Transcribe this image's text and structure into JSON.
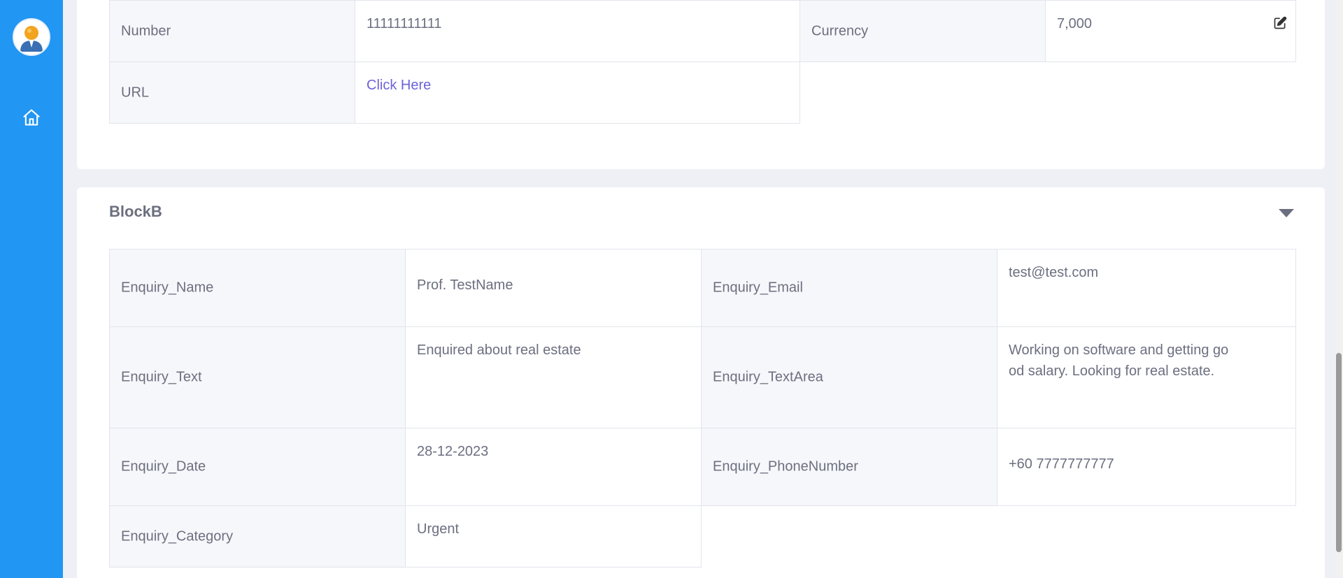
{
  "sidebar": {
    "avatar_icon": "user-avatar-icon",
    "home_icon": "home-icon",
    "color": "#2196f3"
  },
  "blockA": {
    "rows": [
      {
        "label": "Number",
        "value": "11111111111"
      },
      {
        "label": "Currency",
        "value": "7,000"
      },
      {
        "label": "URL",
        "value": "Click Here"
      }
    ]
  },
  "blockB": {
    "title": "BlockB",
    "rows": [
      {
        "label": "Enquiry_Name",
        "value": "Prof.   TestName"
      },
      {
        "label": "Enquiry_Email",
        "value": "test@test.com"
      },
      {
        "label": "Enquiry_Text",
        "value": "Enquired about real estate"
      },
      {
        "label": "Enquiry_TextArea",
        "value": "Working on software and getting good salary. Looking for real estate."
      },
      {
        "label": "Enquiry_Date",
        "value": "28-12-2023"
      },
      {
        "label": "Enquiry_PhoneNumber",
        "value": "+60   7777777777"
      },
      {
        "label": "Enquiry_Category",
        "value": "Urgent"
      }
    ]
  },
  "colors": {
    "accent": "#2196f3",
    "link": "#6c63d9",
    "label_bg": "#f6f7fa",
    "border": "#e3e5ec"
  }
}
